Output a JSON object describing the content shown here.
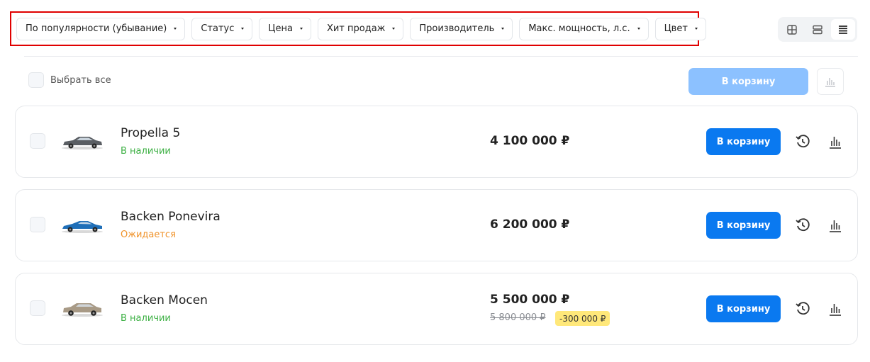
{
  "filters": [
    {
      "label": "По популярности (убывание)"
    },
    {
      "label": "Статус"
    },
    {
      "label": "Цена"
    },
    {
      "label": "Хит продаж"
    },
    {
      "label": "Производитель"
    },
    {
      "label": "Макс. мощность, л.с."
    },
    {
      "label": "Цвет"
    }
  ],
  "view_modes": [
    "grid",
    "list",
    "compact-list"
  ],
  "active_view": "compact-list",
  "select_all_label": "Выбрать все",
  "cart_all_label": "В корзину",
  "products": [
    {
      "name": "Propella 5",
      "status": "В наличии",
      "status_type": "in-stock",
      "price": "4 100 000 ₽",
      "old_price": "",
      "discount": "",
      "car_color": "#5a5e63",
      "cart_label": "В корзину"
    },
    {
      "name": "Backen Ponevira",
      "status": "Ожидается",
      "status_type": "expected",
      "price": "6 200 000 ₽",
      "old_price": "",
      "discount": "",
      "car_color": "#1f6fb8",
      "cart_label": "В корзину"
    },
    {
      "name": "Backen Mocen",
      "status": "В наличии",
      "status_type": "in-stock",
      "price": "5 500 000 ₽",
      "old_price": "5 800 000 ₽",
      "discount": "-300 000 ₽",
      "car_color": "#a89a86",
      "cart_label": "В корзину"
    }
  ],
  "colors": {
    "accent": "#0a79f0",
    "accent_disabled": "#8cc1ff",
    "in_stock": "#3cb043",
    "expected": "#f0932b",
    "discount_bg": "#ffe87a",
    "highlight_border": "#e00000"
  }
}
